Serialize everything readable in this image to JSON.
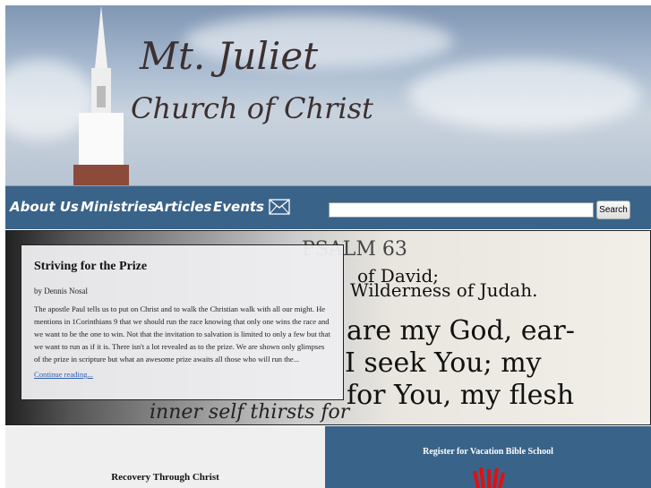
{
  "header": {
    "title_line1": "Mt. Juliet",
    "title_line2": "Church of Christ"
  },
  "nav": {
    "items": [
      {
        "label": "About Us"
      },
      {
        "label": "Ministries"
      },
      {
        "label": "Articles"
      },
      {
        "label": "Events"
      }
    ],
    "mail_icon": "envelope-icon",
    "search_placeholder": "",
    "search_value": "",
    "search_label": "Search"
  },
  "hero": {
    "bible_text": [
      "PSALM 63",
      "of David;",
      "Wilderness of Judah.",
      "are my God, ear-",
      "I seek You; my",
      "for You, my flesh",
      "inner self thirsts for"
    ]
  },
  "article": {
    "title": "Striving for the Prize",
    "byline": "by Dennis Nosal",
    "excerpt": "The apostle Paul tells us to put on Christ and to walk the Christian walk with all our might. He mentions in 1Corinthians 9 that we should run the race knowing that only one wins the race and we want to be the one to win. Not that the invitation to salvation is limited to only a few but that we want to run as if it is. There isn't a lot revealed as to the prize. We are shown only glimpses of the prize in scripture but what an awesome prize awaits all those who will run the...",
    "more": "Continue reading..."
  },
  "bottom": {
    "left_title": "Recovery Through Christ",
    "right_title": "Register for Vacation Bible School"
  },
  "colors": {
    "nav": "#3a6389",
    "link": "#2a5db0"
  }
}
